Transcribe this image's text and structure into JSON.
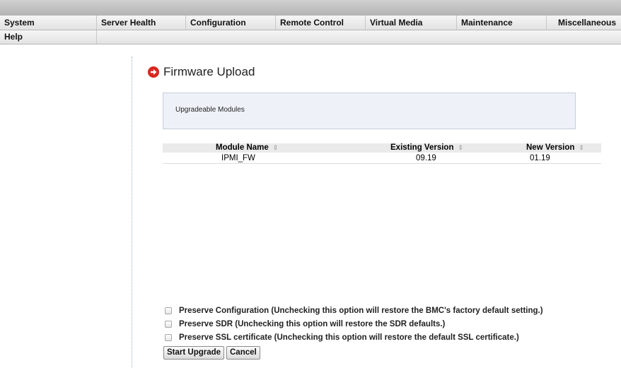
{
  "nav": {
    "row1": [
      "System",
      "Server Health",
      "Configuration",
      "Remote Control",
      "Virtual Media",
      "Maintenance",
      "Miscellaneous"
    ],
    "row2": [
      "Help"
    ]
  },
  "page": {
    "title": "Firmware Upload",
    "modules_label": "Upgradeable Modules"
  },
  "table": {
    "headers": [
      "Module Name",
      "Existing Version",
      "New Version"
    ],
    "sort_icon": "⇕",
    "rows": [
      [
        "IPMI_FW",
        "09.19",
        "01.19"
      ]
    ]
  },
  "options": [
    {
      "label": "Preserve Configuration (Unchecking this option will restore the BMC's factory default setting.)",
      "checked": false
    },
    {
      "label": "Preserve SDR (Unchecking this option will restore the SDR defaults.)",
      "checked": false
    },
    {
      "label": "Preserve SSL certificate (Unchecking this option will restore the default SSL certificate.)",
      "checked": false
    }
  ],
  "buttons": {
    "start": "Start Upgrade",
    "cancel": "Cancel"
  },
  "colors": {
    "accent_icon": "#d9261c",
    "modules_box": "#eef2f8"
  },
  "icons": {
    "title": "arrow-right-circle-icon",
    "sort": "sort-icon"
  }
}
